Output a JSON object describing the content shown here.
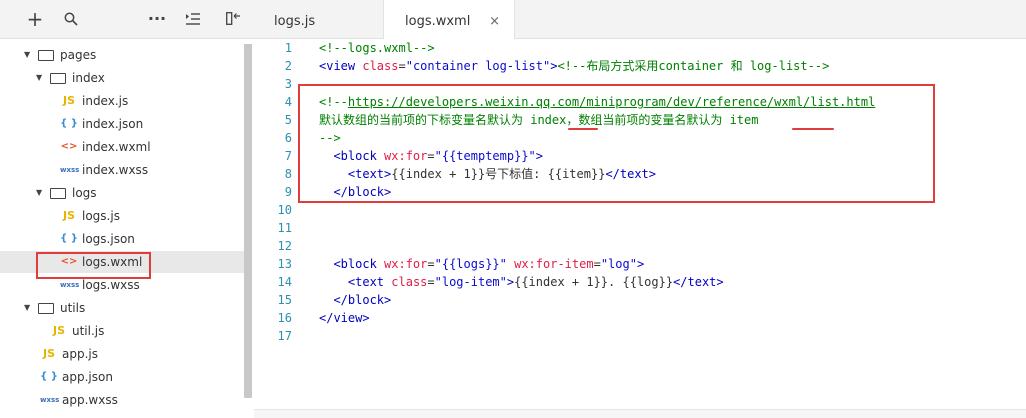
{
  "toolbar": {
    "icons": [
      "plus-icon",
      "search-icon",
      "more-icon",
      "collapse-icon",
      "split-icon"
    ]
  },
  "tree": [
    {
      "label": "pages",
      "type": "folder",
      "level": 0
    },
    {
      "label": "index",
      "type": "folder",
      "level": 1
    },
    {
      "label": "index.js",
      "type": "js",
      "level": 2
    },
    {
      "label": "index.json",
      "type": "json",
      "level": 2
    },
    {
      "label": "index.wxml",
      "type": "wxml",
      "level": 2
    },
    {
      "label": "index.wxss",
      "type": "wxss",
      "level": 2
    },
    {
      "label": "logs",
      "type": "folder",
      "level": 1
    },
    {
      "label": "logs.js",
      "type": "js",
      "level": 2
    },
    {
      "label": "logs.json",
      "type": "json",
      "level": 2
    },
    {
      "label": "logs.wxml",
      "type": "wxml",
      "level": 2,
      "selected": true
    },
    {
      "label": "logs.wxss",
      "type": "wxss",
      "level": 2
    },
    {
      "label": "utils",
      "type": "folder",
      "level": 0
    },
    {
      "label": "util.js",
      "type": "js",
      "level": 1
    },
    {
      "label": "app.js",
      "type": "js",
      "level": 0
    },
    {
      "label": "app.json",
      "type": "json",
      "level": 0
    },
    {
      "label": "app.wxss",
      "type": "wxss",
      "level": 0
    }
  ],
  "icon_glyphs": {
    "js": "JS",
    "json": "{ }",
    "wxml": "<>",
    "wxss": "wxss"
  },
  "tabs": [
    {
      "label": "logs.js",
      "active": false
    },
    {
      "label": "logs.wxml",
      "active": true,
      "close": "×"
    }
  ],
  "code_lines": [
    {
      "n": "1",
      "segs": [
        [
          "c",
          "<!--logs.wxml-->"
        ]
      ]
    },
    {
      "n": "2",
      "segs": [
        [
          "t",
          "<view "
        ],
        [
          "a",
          "class"
        ],
        [
          "p",
          "="
        ],
        [
          "s",
          "\"container log-list\""
        ],
        [
          "t",
          ">"
        ],
        [
          "c",
          "<!--布局方式采用container 和 log-list-->"
        ]
      ]
    },
    {
      "n": "3",
      "segs": []
    },
    {
      "n": "4",
      "segs": [
        [
          "c",
          "<!--"
        ],
        [
          "c ul",
          "https://developers.weixin.qq.com/miniprogram/dev/reference/wxml/list.html"
        ]
      ]
    },
    {
      "n": "5",
      "segs": [
        [
          "c",
          "默认数组的当前项的下标变量名默认为 index，数组当前项的变量名默认为 item"
        ]
      ]
    },
    {
      "n": "6",
      "segs": [
        [
          "c",
          "-->"
        ]
      ]
    },
    {
      "n": "7",
      "segs": [
        [
          "p",
          "  "
        ],
        [
          "t",
          "<block "
        ],
        [
          "a",
          "wx:for"
        ],
        [
          "p",
          "="
        ],
        [
          "s",
          "\"{{temptemp}}\""
        ],
        [
          "t",
          ">"
        ]
      ]
    },
    {
      "n": "8",
      "segs": [
        [
          "p",
          "    "
        ],
        [
          "t",
          "<text>"
        ],
        [
          "p",
          "{{index + 1}}号下标值: {{item}}"
        ],
        [
          "t",
          "</text>"
        ]
      ]
    },
    {
      "n": "9",
      "segs": [
        [
          "p",
          "  "
        ],
        [
          "t",
          "</block>"
        ]
      ]
    },
    {
      "n": "10",
      "segs": []
    },
    {
      "n": "11",
      "segs": []
    },
    {
      "n": "12",
      "segs": []
    },
    {
      "n": "13",
      "segs": [
        [
          "p",
          "  "
        ],
        [
          "t",
          "<block "
        ],
        [
          "a",
          "wx:for"
        ],
        [
          "p",
          "="
        ],
        [
          "s",
          "\"{{logs}}\""
        ],
        [
          "p",
          " "
        ],
        [
          "a",
          "wx:for-item"
        ],
        [
          "p",
          "="
        ],
        [
          "s",
          "\"log\""
        ],
        [
          "t",
          ">"
        ]
      ]
    },
    {
      "n": "14",
      "segs": [
        [
          "p",
          "    "
        ],
        [
          "t",
          "<text "
        ],
        [
          "a",
          "class"
        ],
        [
          "p",
          "="
        ],
        [
          "s",
          "\"log-item\""
        ],
        [
          "t",
          ">"
        ],
        [
          "p",
          "{{index + 1}}. {{log}}"
        ],
        [
          "t",
          "</text>"
        ]
      ]
    },
    {
      "n": "15",
      "segs": [
        [
          "p",
          "  "
        ],
        [
          "t",
          "</block>"
        ]
      ]
    },
    {
      "n": "16",
      "segs": [
        [
          "t",
          "</view>"
        ]
      ]
    },
    {
      "n": "17",
      "segs": []
    }
  ]
}
